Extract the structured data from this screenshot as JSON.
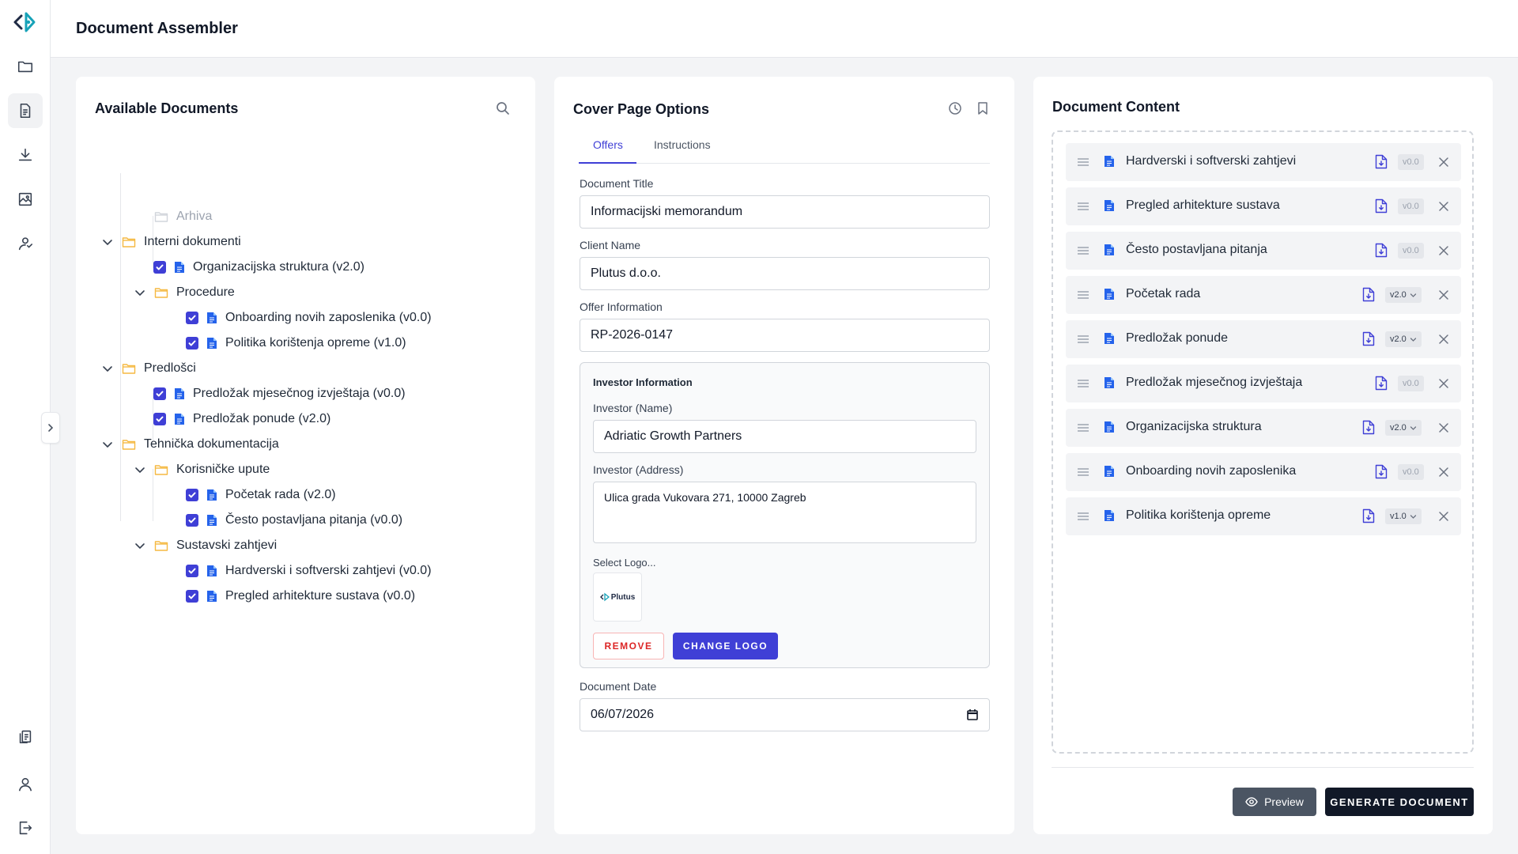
{
  "app": {
    "title": "Document Assembler"
  },
  "rail": {
    "items": [
      {
        "icon": "folder-icon"
      },
      {
        "icon": "document-icon",
        "active": true
      },
      {
        "icon": "download-icon"
      },
      {
        "icon": "image-icon"
      },
      {
        "icon": "users-icon"
      },
      {
        "icon": "clipboard-icon"
      },
      {
        "icon": "user-icon"
      },
      {
        "icon": "logout-icon"
      }
    ]
  },
  "available": {
    "title": "Available Documents",
    "tree": [
      {
        "label": "Arhiva",
        "type": "folder",
        "level": 1,
        "muted": true,
        "expandable": false
      },
      {
        "label": "Interni dokumenti",
        "type": "folder",
        "level": 0,
        "expanded": true
      },
      {
        "label": "Organizacijska struktura (v2.0)",
        "type": "doc",
        "level": 1,
        "checked": true
      },
      {
        "label": "Procedure",
        "type": "folder",
        "level": 1,
        "expanded": true
      },
      {
        "label": "Onboarding novih zaposlenika (v0.0)",
        "type": "doc",
        "level": 2,
        "checked": true
      },
      {
        "label": "Politika korištenja opreme (v1.0)",
        "type": "doc",
        "level": 2,
        "checked": true
      },
      {
        "label": "Predlošci",
        "type": "folder",
        "level": 0,
        "expanded": true
      },
      {
        "label": "Predložak mjesečnog izvještaja (v0.0)",
        "type": "doc",
        "level": 1,
        "checked": true
      },
      {
        "label": "Predložak ponude (v2.0)",
        "type": "doc",
        "level": 1,
        "checked": true
      },
      {
        "label": "Tehnička dokumentacija",
        "type": "folder",
        "level": 0,
        "expanded": true
      },
      {
        "label": "Korisničke upute",
        "type": "folder",
        "level": 1,
        "expanded": true
      },
      {
        "label": "Početak rada (v2.0)",
        "type": "doc",
        "level": 2,
        "checked": true
      },
      {
        "label": "Često postavljana pitanja (v0.0)",
        "type": "doc",
        "level": 2,
        "checked": true
      },
      {
        "label": "Sustavski zahtjevi",
        "type": "folder",
        "level": 1,
        "expanded": true
      },
      {
        "label": "Hardverski i softverski zahtjevi (v0.0)",
        "type": "doc",
        "level": 2,
        "checked": true
      },
      {
        "label": "Pregled arhitekture sustava (v0.0)",
        "type": "doc",
        "level": 2,
        "checked": true
      }
    ]
  },
  "cover": {
    "title": "Cover Page Options",
    "tabs": [
      {
        "label": "Offers",
        "active": true
      },
      {
        "label": "Instructions",
        "active": false
      }
    ],
    "document_title_label": "Document Title",
    "document_title_value": "Informacijski memorandum",
    "client_name_label": "Client Name",
    "client_name_value": "Plutus d.o.o.",
    "offer_info_label": "Offer Information",
    "offer_info_value": "RP-2026-0147",
    "investor": {
      "section_title": "Investor Information",
      "name_label": "Investor (Name)",
      "name_value": "Adriatic Growth Partners",
      "address_label": "Investor (Address)",
      "address_value": "Ulica grada Vukovara 271, 10000 Zagreb",
      "logo_label": "Select Logo...",
      "logo_text": "Plutus",
      "remove_label": "REMOVE",
      "change_logo_label": "CHANGE LOGO"
    },
    "document_date_label": "Document Date",
    "document_date_value": "06/07/2026"
  },
  "content": {
    "title": "Document Content",
    "items": [
      {
        "title": "Hardverski i softverski zahtjevi",
        "version": "v0.0",
        "dropdown": false
      },
      {
        "title": "Pregled arhitekture sustava",
        "version": "v0.0",
        "dropdown": false
      },
      {
        "title": "Često postavljana pitanja",
        "version": "v0.0",
        "dropdown": false
      },
      {
        "title": "Početak rada",
        "version": "v2.0",
        "dropdown": true
      },
      {
        "title": "Predložak ponude",
        "version": "v2.0",
        "dropdown": true
      },
      {
        "title": "Predložak mjesečnog izvještaja",
        "version": "v0.0",
        "dropdown": false
      },
      {
        "title": "Organizacijska struktura",
        "version": "v2.0",
        "dropdown": true
      },
      {
        "title": "Onboarding novih zaposlenika",
        "version": "v0.0",
        "dropdown": false
      },
      {
        "title": "Politika korištenja opreme",
        "version": "v1.0",
        "dropdown": true
      }
    ],
    "preview_label": "Preview",
    "generate_label": "GENERATE DOCUMENT"
  },
  "colors": {
    "accent": "#3f3fd6",
    "doc_icon": "#2563eb",
    "folder": "#f5b942",
    "danger": "#dc2626",
    "dark_button": "#111827"
  }
}
